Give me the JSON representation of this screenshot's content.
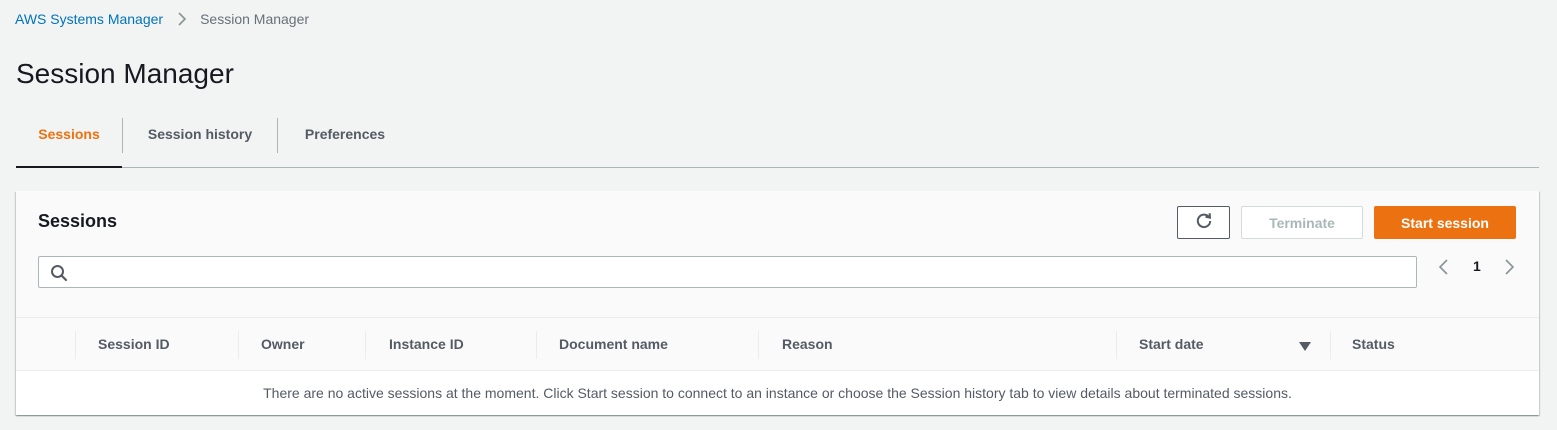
{
  "breadcrumb": {
    "root": "AWS Systems Manager",
    "current": "Session Manager"
  },
  "page": {
    "title": "Session Manager"
  },
  "tabs": [
    {
      "label": "Sessions",
      "active": true
    },
    {
      "label": "Session history",
      "active": false
    },
    {
      "label": "Preferences",
      "active": false
    }
  ],
  "sessions_panel": {
    "title": "Sessions",
    "buttons": {
      "refresh_icon": "refresh-icon",
      "terminate_label": "Terminate",
      "start_label": "Start session"
    },
    "search": {
      "value": "",
      "placeholder": ""
    },
    "pagination": {
      "current_page": "1"
    },
    "table": {
      "columns": [
        "Session ID",
        "Owner",
        "Instance ID",
        "Document name",
        "Reason",
        "Start date",
        "Status"
      ],
      "sorted_column": "Start date",
      "sort_direction": "descending",
      "empty_message": "There are no active sessions at the moment. Click Start session to connect to an instance or choose the Session history tab to view details about terminated sessions."
    }
  },
  "colors": {
    "accent": "#ec7211",
    "link": "#0073bb",
    "text": "#16191f",
    "muted": "#545b64",
    "background": "#f2f3f3"
  }
}
